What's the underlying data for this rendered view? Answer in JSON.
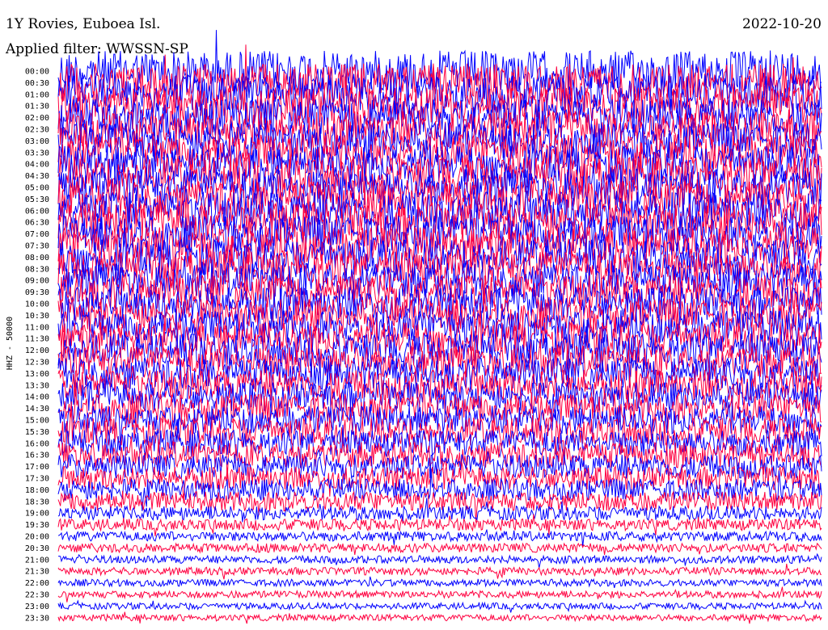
{
  "header": {
    "station": "1Y Rovies, Euboea Isl.",
    "date": "2022-10-20",
    "filter": "Applied filter: WWSSN-SP"
  },
  "chart_data": {
    "type": "helicorder",
    "ylabel": "HHZ - 50000",
    "row_labels": [
      "00:00",
      "00:30",
      "01:00",
      "01:30",
      "02:00",
      "02:30",
      "03:00",
      "03:30",
      "04:00",
      "04:30",
      "05:00",
      "05:30",
      "06:00",
      "06:30",
      "07:00",
      "07:30",
      "08:00",
      "08:30",
      "09:00",
      "09:30",
      "10:00",
      "10:30",
      "11:00",
      "11:30",
      "12:00",
      "12:30",
      "13:00",
      "13:30",
      "14:00",
      "14:30",
      "15:00",
      "15:30",
      "16:00",
      "16:30",
      "17:00",
      "17:30",
      "18:00",
      "18:30",
      "19:00",
      "19:30",
      "20:00",
      "20:30",
      "21:00",
      "21:30",
      "22:00",
      "22:30",
      "23:00",
      "23:30"
    ],
    "row_minutes": 30,
    "colors": [
      "#0000ff",
      "#ff0040"
    ],
    "relative_amplitude": [
      3.2,
      3.0,
      3.0,
      2.9,
      2.9,
      2.8,
      2.8,
      2.8,
      2.9,
      2.9,
      2.9,
      3.0,
      3.0,
      3.0,
      2.9,
      2.9,
      2.8,
      2.8,
      2.7,
      2.7,
      2.6,
      2.6,
      2.6,
      2.6,
      2.6,
      2.5,
      2.5,
      2.4,
      2.3,
      2.3,
      2.2,
      2.2,
      2.1,
      2.0,
      1.9,
      1.8,
      1.7,
      1.5,
      1.1,
      0.9,
      0.75,
      0.7,
      0.6,
      0.6,
      0.55,
      0.55,
      0.5,
      0.5
    ]
  }
}
